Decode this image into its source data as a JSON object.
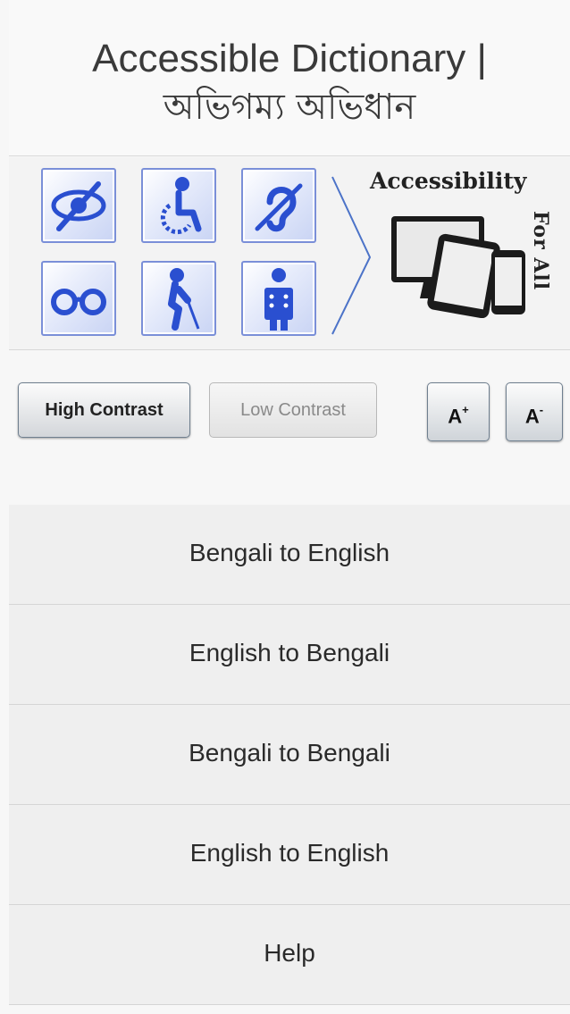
{
  "header": {
    "title_en": "Accessible Dictionary |",
    "title_bn": "অভিগম্য অভিধান"
  },
  "banner": {
    "tiles": [
      {
        "icon": "visually-impaired-icon"
      },
      {
        "icon": "wheelchair-user-icon"
      },
      {
        "icon": "hearing-impaired-icon"
      },
      {
        "icon": "low-vision-glasses-icon"
      },
      {
        "icon": "blind-person-cane-icon"
      },
      {
        "icon": "braille-reader-icon"
      }
    ],
    "heading": "Accessibility",
    "subheading": "For All",
    "accent_color": "#3a5fd0"
  },
  "controls": {
    "high_contrast": "High Contrast",
    "low_contrast": "Low Contrast",
    "font_increase": "A",
    "font_increase_sup": "+",
    "font_decrease": "A",
    "font_decrease_sup": "-"
  },
  "menu": {
    "items": [
      {
        "label": "Bengali to English"
      },
      {
        "label": "English to Bengali"
      },
      {
        "label": "Bengali to Bengali"
      },
      {
        "label": "English to English"
      },
      {
        "label": "Help"
      }
    ]
  }
}
